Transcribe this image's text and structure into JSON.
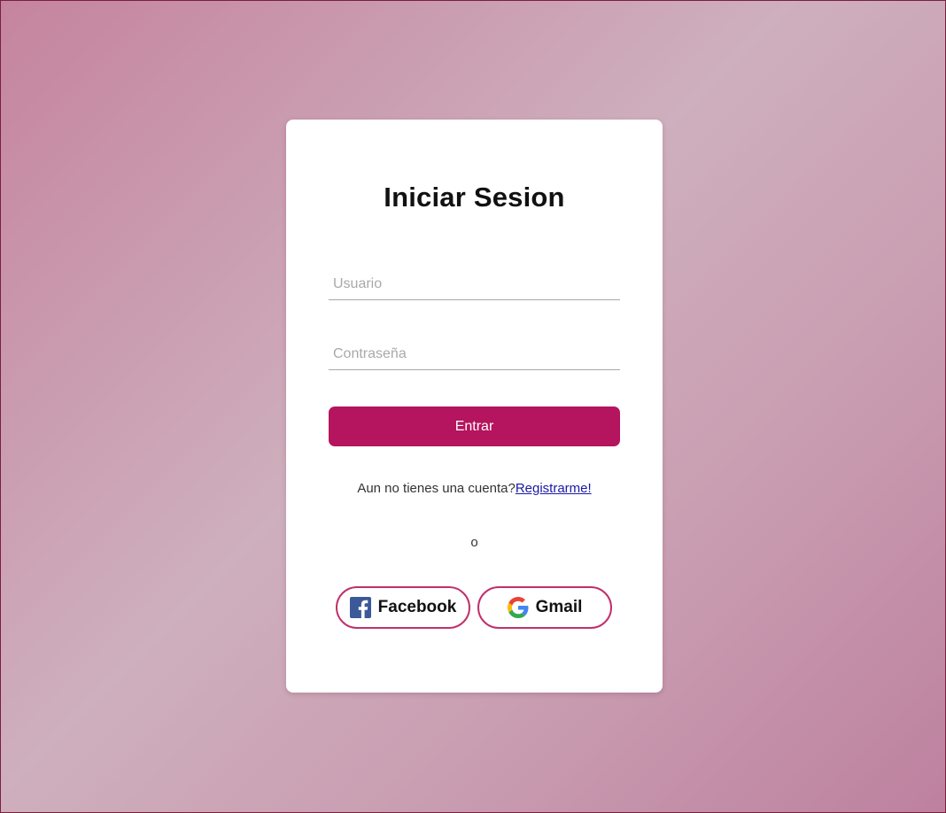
{
  "login": {
    "title": "Iniciar Sesion",
    "username_placeholder": "Usuario",
    "username_value": "",
    "password_placeholder": "Contraseña",
    "password_value": "",
    "submit_label": "Entrar",
    "register_prompt": "Aun no tienes una cuenta?",
    "register_link": "Registrarme!",
    "or_text": "o"
  },
  "social": {
    "facebook_label": "Facebook",
    "facebook_icon": "facebook-icon",
    "gmail_label": "Gmail",
    "gmail_icon": "google-icon"
  },
  "colors": {
    "accent": "#b5145e",
    "social_border": "#c0306c",
    "link": "#1a1aa6",
    "background_start": "#c5849e",
    "background_end": "#bd819f"
  }
}
